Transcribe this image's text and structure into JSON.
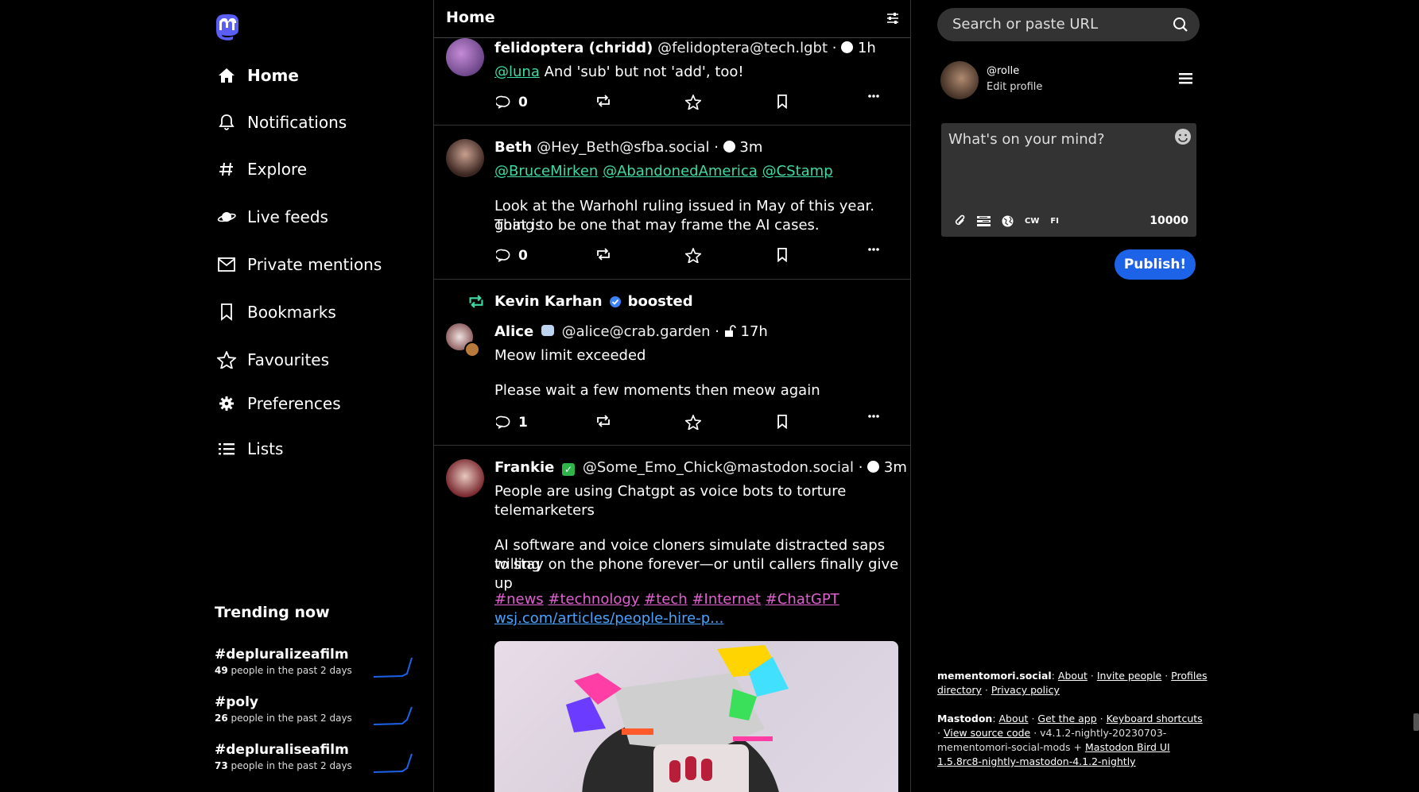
{
  "nav": {
    "items": [
      {
        "label": "Home",
        "icon": "home-icon"
      },
      {
        "label": "Notifications",
        "icon": "bell-icon"
      },
      {
        "label": "Explore",
        "icon": "hashtag-icon"
      },
      {
        "label": "Live feeds",
        "icon": "planet-icon"
      },
      {
        "label": "Private mentions",
        "icon": "mail-icon"
      },
      {
        "label": "Bookmarks",
        "icon": "bookmark-icon"
      },
      {
        "label": "Favourites",
        "icon": "star-icon"
      },
      {
        "label": "Preferences",
        "icon": "gear-icon"
      },
      {
        "label": "Lists",
        "icon": "list-icon"
      }
    ]
  },
  "trending": {
    "title": "Trending now",
    "items": [
      {
        "tag": "#depluralizeafilm",
        "count": "49",
        "suffix": "people in the past 2 days"
      },
      {
        "tag": "#poly",
        "count": "26",
        "suffix": "people in the past 2 days"
      },
      {
        "tag": "#depluraliseafilm",
        "count": "73",
        "suffix": "people in the past 2 days"
      }
    ]
  },
  "timeline": {
    "title": "Home",
    "posts": [
      {
        "name": "felidoptera (chridd)",
        "handle": "@felidoptera@tech.lgbt",
        "time": "1h",
        "mention": "@luna",
        "text": "And 'sub' but not 'add', too!",
        "replies": "0"
      },
      {
        "name": "Beth",
        "handle": "@Hey_Beth@sfba.social",
        "time": "3m",
        "mentions": [
          "@BruceMirken",
          "@AbandonedAmerica",
          "@CStamp"
        ],
        "text1": "Look at the Warhohl ruling issued in May of this year. That is",
        "text2": "going to be one that may frame the AI cases.",
        "replies": "0"
      },
      {
        "booster": "Kevin Karhan",
        "boosted_label": "boosted",
        "name": "Alice",
        "handle": "@alice@crab.garden",
        "time": "17h",
        "text1": "Meow limit exceeded",
        "text2": "Please wait a few moments then meow again",
        "replies": "1"
      },
      {
        "name": "Frankie",
        "handle": "@Some_Emo_Chick@mastodon.social",
        "time": "3m",
        "text1": "People are using Chatgpt as voice bots to torture",
        "text2": "telemarketers",
        "text3": "AI software and voice cloners simulate distracted saps willing",
        "text4": "to stay on the phone forever—or until callers finally give up",
        "hashtags": [
          "#news",
          "#technology",
          "#tech",
          "#Internet",
          "#ChatGPT"
        ],
        "link": "wsj.com/articles/people-hire-p..."
      }
    ]
  },
  "search": {
    "placeholder": "Search or paste URL"
  },
  "profile": {
    "handle": "@rolle",
    "edit": "Edit profile"
  },
  "composer": {
    "placeholder": "What's on your mind?",
    "cw": "CW",
    "lang": "FI",
    "count": "10000",
    "publish": "Publish!"
  },
  "footer": {
    "server": "mementomori.social",
    "server_links": [
      "About",
      "Invite people",
      "Profiles directory",
      "Privacy policy"
    ],
    "mastodon": "Mastodon",
    "mastodon_links": [
      "About",
      "Get the app",
      "Keyboard shortcuts",
      "View source code"
    ],
    "version": "v4.1.2-nightly-20230703-mementomori-social-mods +",
    "bird": "Mastodon Bird UI 1.5.8rc8-nightly-mastodon-4.1.2-nightly"
  },
  "colors": {
    "accent": "#1c63e8",
    "mention": "#40d9a4",
    "hashtag": "#e060d0",
    "link": "#4aa3ff"
  }
}
